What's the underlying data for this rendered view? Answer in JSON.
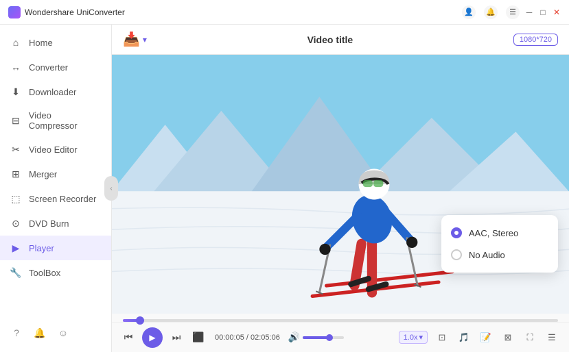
{
  "titleBar": {
    "appName": "Wondershare UniConverter",
    "icons": {
      "user": "👤",
      "bell": "🔔",
      "menu": "☰",
      "minimize": "─",
      "maximize": "□",
      "close": "✕"
    }
  },
  "sidebar": {
    "items": [
      {
        "id": "home",
        "label": "Home",
        "icon": "⌂",
        "active": false
      },
      {
        "id": "converter",
        "label": "Converter",
        "icon": "↔",
        "active": false
      },
      {
        "id": "downloader",
        "label": "Downloader",
        "icon": "⬇",
        "active": false
      },
      {
        "id": "video-compressor",
        "label": "Video Compressor",
        "icon": "⊟",
        "active": false
      },
      {
        "id": "video-editor",
        "label": "Video Editor",
        "icon": "✂",
        "active": false
      },
      {
        "id": "merger",
        "label": "Merger",
        "icon": "⊞",
        "active": false
      },
      {
        "id": "screen-recorder",
        "label": "Screen Recorder",
        "icon": "⬚",
        "active": false
      },
      {
        "id": "dvd-burn",
        "label": "DVD Burn",
        "icon": "⊙",
        "active": false
      },
      {
        "id": "player",
        "label": "Player",
        "icon": "▶",
        "active": true
      },
      {
        "id": "toolbox",
        "label": "ToolBox",
        "icon": "🔧",
        "active": false
      }
    ],
    "bottomIcons": {
      "help": "?",
      "bell": "🔔",
      "settings": "☺"
    }
  },
  "topBar": {
    "addIcon": "📥",
    "chevron": "▾",
    "title": "Video title",
    "resolution": "1080*720"
  },
  "audioDropdown": {
    "options": [
      {
        "id": "aac-stereo",
        "label": "AAC, Stereo",
        "selected": true
      },
      {
        "id": "no-audio",
        "label": "No Audio",
        "selected": false
      }
    ]
  },
  "controls": {
    "timeDisplay": "00:00:05 / 02:05:06",
    "speed": "1.0x",
    "speedChevron": "▾"
  }
}
